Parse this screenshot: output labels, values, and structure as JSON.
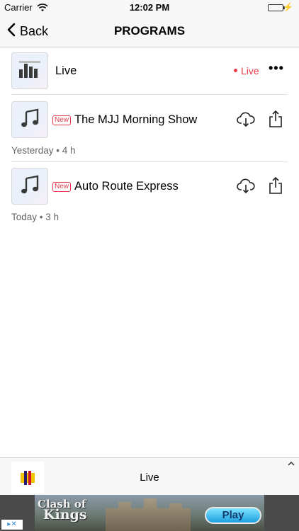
{
  "status_bar": {
    "carrier": "Carrier",
    "time": "12:02 PM"
  },
  "nav": {
    "back_label": "Back",
    "title": "PROGRAMS"
  },
  "live_row": {
    "title": "Live",
    "status": "Live"
  },
  "programs": [
    {
      "badge": "New",
      "title": "The MJJ Morning Show",
      "meta": "Yesterday • 4 h"
    },
    {
      "badge": "New",
      "title": "Auto Route Express",
      "meta": "Today • 3 h"
    }
  ],
  "mini_player": {
    "title": "Live"
  },
  "ad": {
    "brand_line1": "Clash of",
    "brand_line2": "Kings",
    "cta": "Play"
  },
  "colors": {
    "accent": "#e8394a",
    "battery": "#4cd964"
  },
  "icons": [
    "wifi-icon",
    "battery-icon",
    "back-chevron-icon",
    "equalizer-icon",
    "music-note-icon",
    "cloud-download-icon",
    "share-icon",
    "more-icon",
    "chevron-up-icon",
    "ad-choices-icon"
  ]
}
